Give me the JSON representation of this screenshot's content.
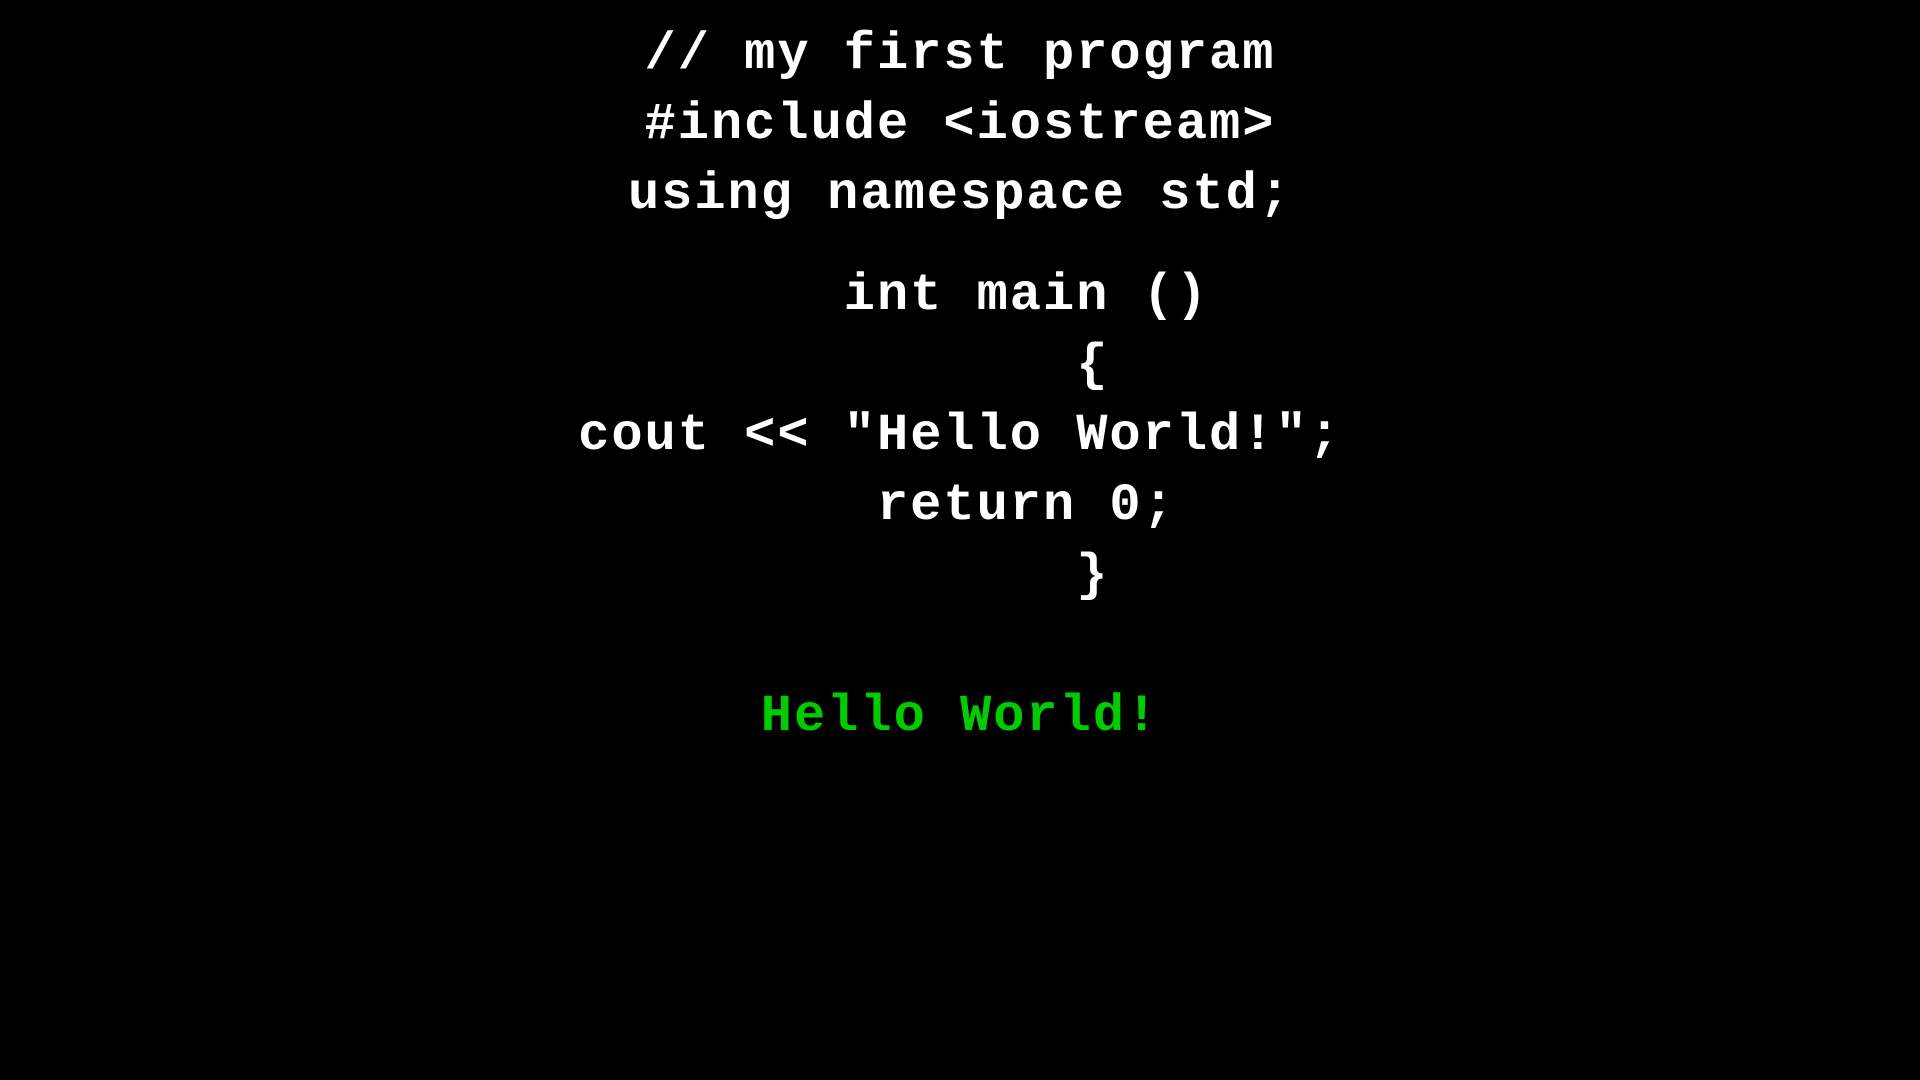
{
  "code": {
    "lines": [
      {
        "id": "comment",
        "text": "// my first program",
        "type": "code"
      },
      {
        "id": "include",
        "text": "#include <iostream>",
        "type": "code"
      },
      {
        "id": "namespace",
        "text": "using namespace std;",
        "type": "code"
      },
      {
        "id": "blank1",
        "text": "",
        "type": "blank"
      },
      {
        "id": "main",
        "text": "    int main ()",
        "type": "code"
      },
      {
        "id": "open-brace",
        "text": "        {",
        "type": "code"
      },
      {
        "id": "cout",
        "text": "cout << \"Hello World!\";",
        "type": "code"
      },
      {
        "id": "return",
        "text": "    return 0;",
        "type": "code"
      },
      {
        "id": "close-brace",
        "text": "        }",
        "type": "code"
      },
      {
        "id": "blank2",
        "text": "",
        "type": "blank"
      },
      {
        "id": "output",
        "text": "Hello World!",
        "type": "output"
      }
    ]
  }
}
